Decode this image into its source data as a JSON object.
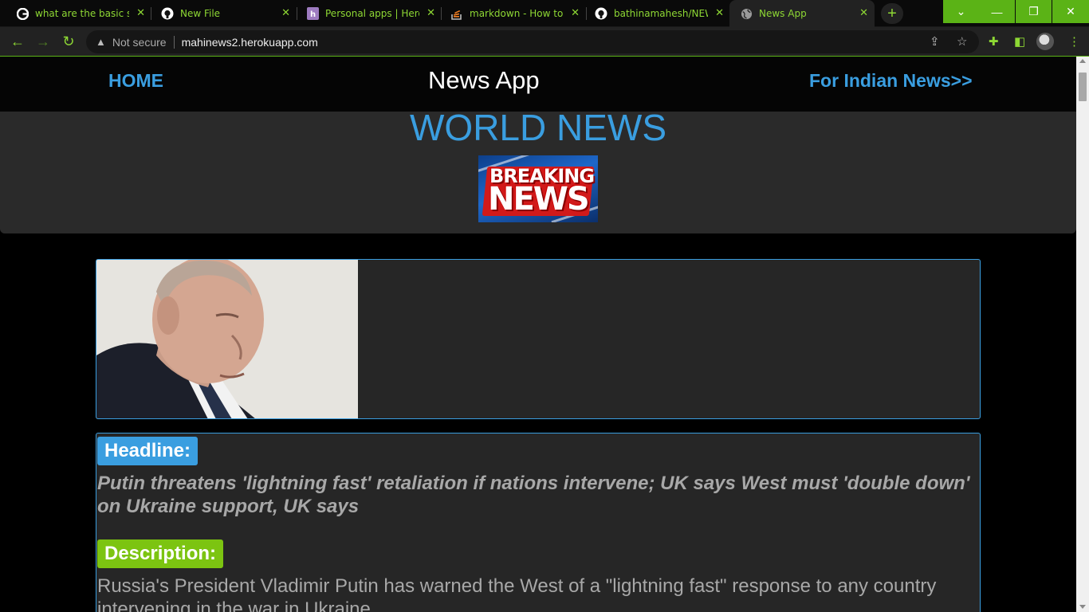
{
  "browser": {
    "tabs": [
      {
        "title": "what are the basic steps",
        "favicon": "google-icon"
      },
      {
        "title": "New File",
        "favicon": "github-icon"
      },
      {
        "title": "Personal apps | Heroku",
        "favicon": "heroku-icon"
      },
      {
        "title": "markdown - How to add",
        "favicon": "stackoverflow-icon"
      },
      {
        "title": "bathinamahesh/NEWS",
        "favicon": "github-icon"
      },
      {
        "title": "News App",
        "favicon": "globe-icon",
        "active": true
      }
    ],
    "new_tab_label": "+",
    "security_label": "Not secure",
    "url": "mahinews2.herokuapp.com",
    "accent_color": "#5bb316"
  },
  "navbar": {
    "home_label": "HOME",
    "title": "News App",
    "indian_link": "For Indian News>>"
  },
  "hero": {
    "title": "WORLD NEWS",
    "logo_line1": "BREAKING",
    "logo_line2": "NEWS"
  },
  "article": {
    "headline_label": "Headline:",
    "headline": "Putin threatens 'lightning fast' retaliation if nations intervene; UK says West must 'double down' on Ukraine support, UK says",
    "description_label": "Description:",
    "description": "Russia's President Vladimir Putin has warned the West of a \"lightning fast\" response to any country intervening in the war in Ukraine."
  },
  "colors": {
    "link_blue": "#3a9ee0",
    "description_green": "#7cc411",
    "card_bg": "#262626"
  }
}
